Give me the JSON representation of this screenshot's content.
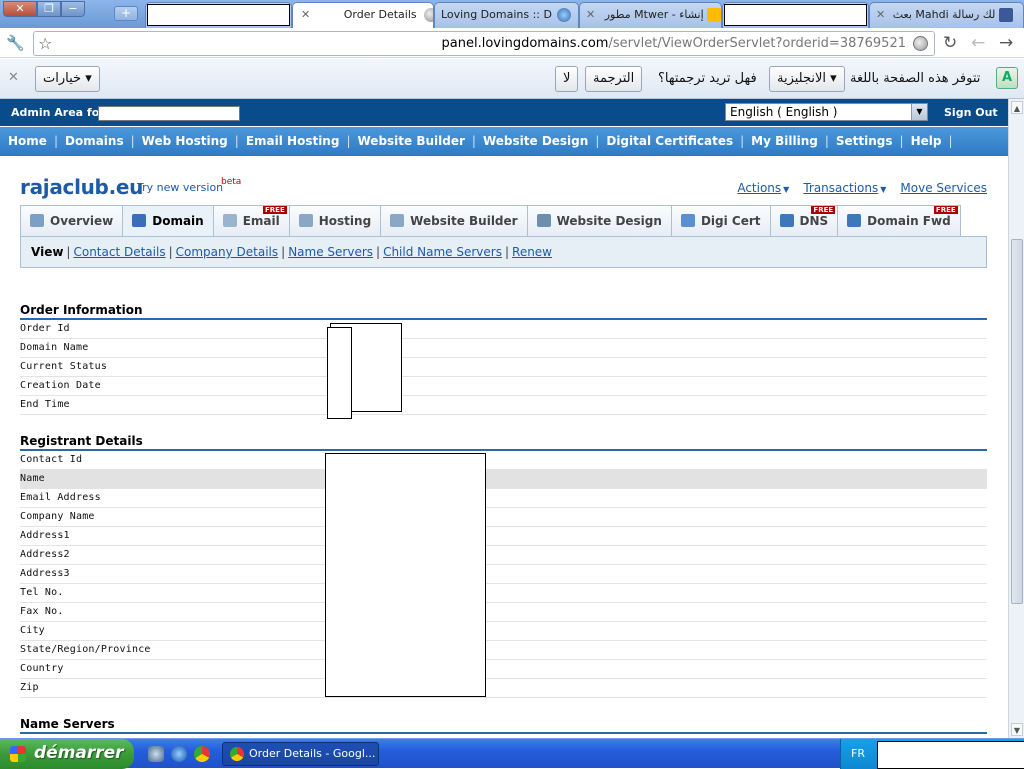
{
  "browser": {
    "tabs": [
      {
        "label": "",
        "redacted": true
      },
      {
        "label": "Order Details",
        "active": true
      },
      {
        "label": "Loving Domains :: D"
      },
      {
        "label": "مطور Mtwer - إنشاء"
      },
      {
        "label": "",
        "redacted": true
      },
      {
        "label": "بعث Mahdi لك رسالة"
      }
    ],
    "url_host": "panel.lovingdomains.com",
    "url_path": "/servlet/ViewOrderServlet?orderid=38769521"
  },
  "translate_bar": {
    "options_label": "خيارات ▾",
    "no_label": "لا",
    "translate_label": "الترجمة",
    "question": "فهل تريد ترجمتها؟",
    "language_label": "الانجليزية ▾",
    "prompt": "تتوفر هذه الصفحة باللغة"
  },
  "admin": {
    "label": "Admin Area for",
    "language": "English ( English )",
    "sign_out": "Sign Out"
  },
  "nav": [
    "Home",
    "Domains",
    "Web Hosting",
    "Email Hosting",
    "Website Builder",
    "Website Design",
    "Digital Certificates",
    "My Billing",
    "Settings",
    "Help"
  ],
  "site": {
    "title": "rajaclub.eu",
    "try_new": "Try new version",
    "beta": "beta",
    "actions": "Actions",
    "transactions": "Transactions",
    "move_services": "Move Services"
  },
  "tabs": [
    {
      "label": "Overview",
      "color": "#7aa0c8",
      "free": false
    },
    {
      "label": "Domain",
      "color": "#3a6fb8",
      "free": false,
      "active": true
    },
    {
      "label": "Email",
      "color": "#9ab3cf",
      "free": true
    },
    {
      "label": "Hosting",
      "color": "#8aa7c6",
      "free": false
    },
    {
      "label": "Website Builder",
      "color": "#8aa7c6",
      "free": false
    },
    {
      "label": "Website Design",
      "color": "#6d8fae",
      "free": false
    },
    {
      "label": "Digi Cert",
      "color": "#5a8fd0",
      "free": false
    },
    {
      "label": "DNS",
      "color": "#3f78b8",
      "free": true
    },
    {
      "label": "Domain Fwd",
      "color": "#3f78b8",
      "free": true
    }
  ],
  "free_badge": "FREE",
  "subnav": {
    "current": "View",
    "links": [
      "Contact Details",
      "Company Details",
      "Name Servers",
      "Child Name Servers",
      "Renew"
    ]
  },
  "order_info": {
    "heading": "Order Information",
    "fields": [
      "Order Id",
      "Domain Name",
      "Current Status",
      "Creation Date",
      "End Time"
    ]
  },
  "registrant": {
    "heading": "Registrant Details",
    "fields": [
      "Contact Id",
      "Name",
      "Email Address",
      "Company Name",
      "Address1",
      "Address2",
      "Address3",
      "Tel No.",
      "Fax No.",
      "City",
      "State/Region/Province",
      "Country",
      "Zip"
    ]
  },
  "name_servers": {
    "heading": "Name Servers"
  },
  "taskbar": {
    "start": "démarrer",
    "task": "Order Details - Googl...",
    "lang": "FR"
  }
}
